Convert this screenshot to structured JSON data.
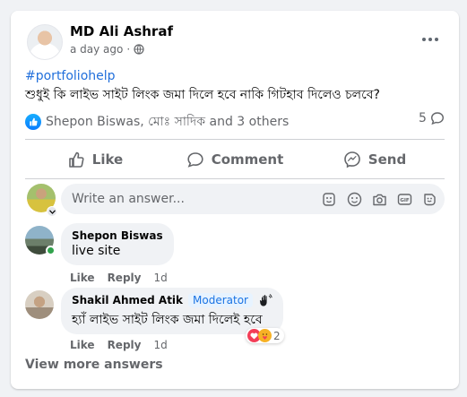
{
  "post": {
    "author": "MD Ali Ashraf",
    "time": "a day ago",
    "privacy_icon": "globe-icon",
    "hashtag": "#portfoliohelp",
    "text": "শুধুই কি লাইভ সাইট লিংক জমা দিলে হবে নাকি গিটহাব দিলেও চলবে?",
    "reactions_text": "Shepon Biswas, মোঃ সাদিক and 3 others",
    "comment_count": "5"
  },
  "actions": {
    "like": "Like",
    "comment": "Comment",
    "send": "Send"
  },
  "composer": {
    "placeholder": "Write an answer..."
  },
  "comments": [
    {
      "name": "Shepon Biswas",
      "text": "live site",
      "like": "Like",
      "reply": "Reply",
      "time": "1d"
    },
    {
      "name": "Shakil Ahmed Atik",
      "badge": "Moderator",
      "text": "হ্যাঁ লাইভ সাইট লিংক জমা দিলেই হবে",
      "like": "Like",
      "reply": "Reply",
      "time": "1d",
      "reaction_count": "2"
    }
  ],
  "view_more": "View more answers",
  "colors": {
    "accent": "#216fdb",
    "moderator": "#1b74e4",
    "secondary_text": "#65676b",
    "bubble": "#f0f2f5"
  }
}
